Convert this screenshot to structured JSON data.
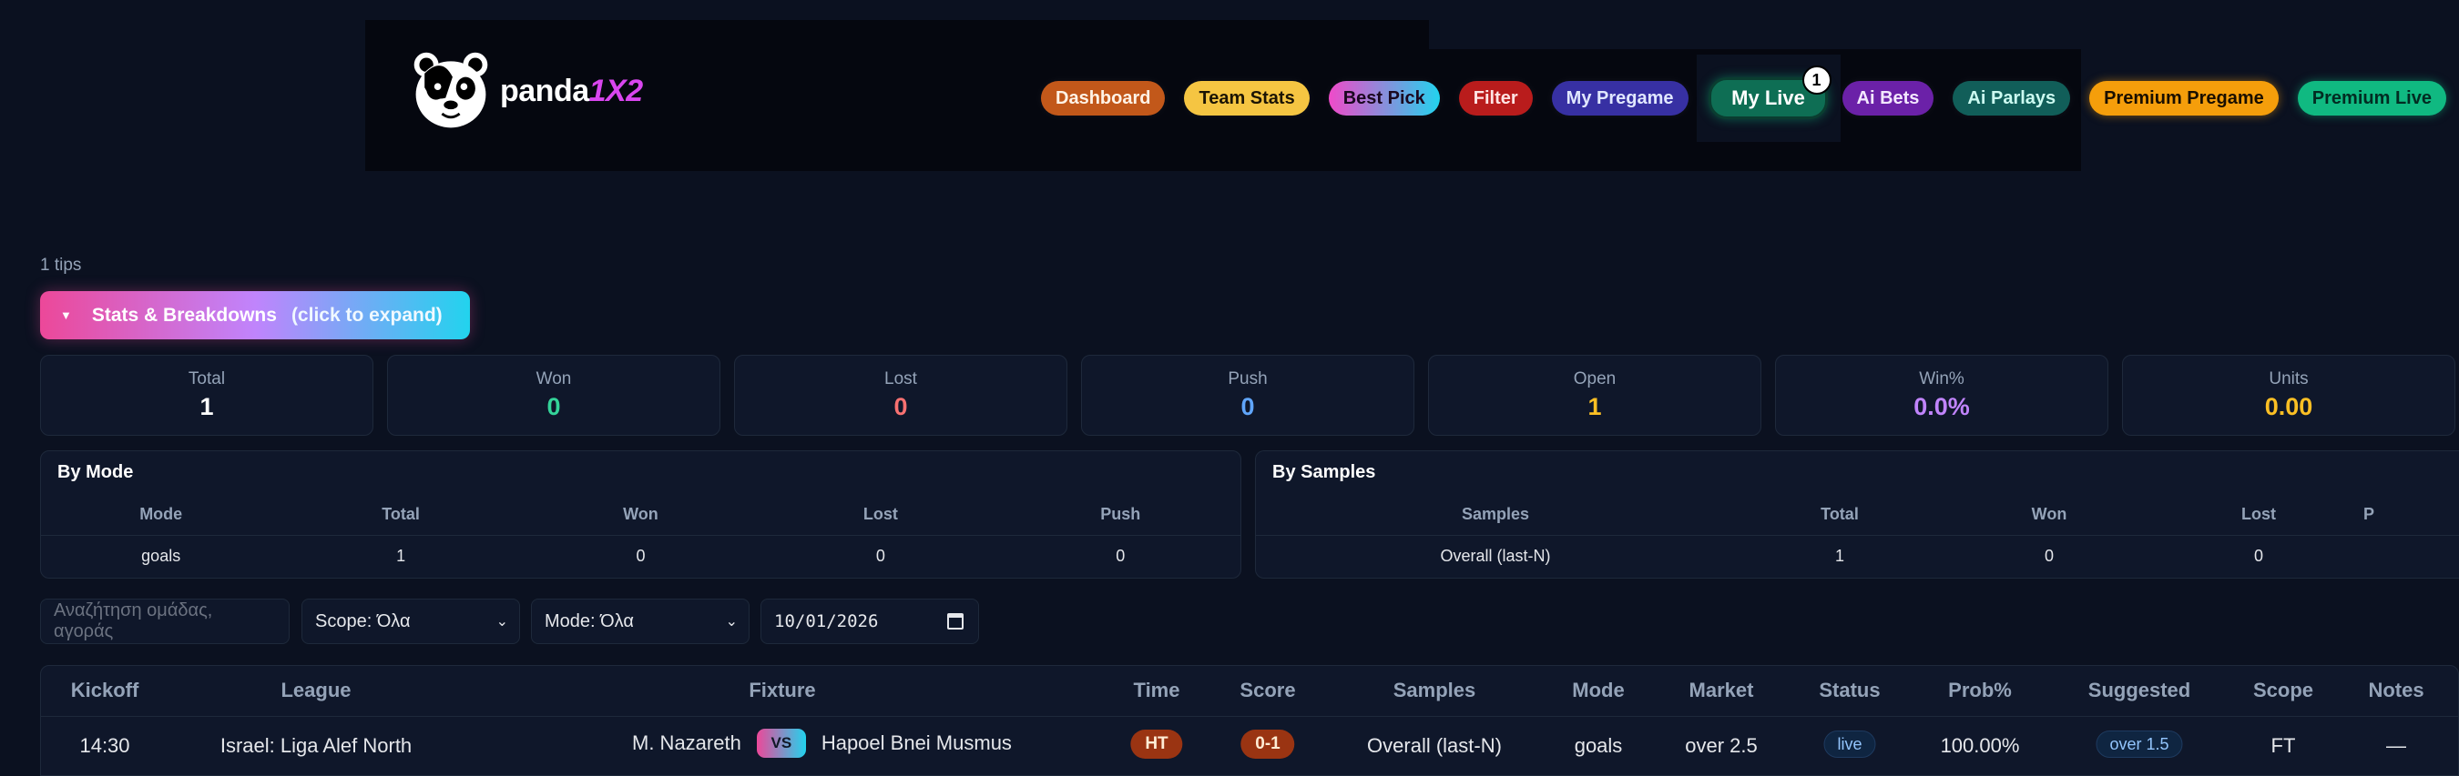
{
  "brand": {
    "name_prefix": "panda",
    "name_accent": "1X2"
  },
  "nav": {
    "items": [
      {
        "label": "Dashboard"
      },
      {
        "label": "Team Stats"
      },
      {
        "label": "Best Pick"
      },
      {
        "label": "Filter"
      },
      {
        "label": "My Pregame"
      },
      {
        "label": "My Live",
        "badge": "1"
      },
      {
        "label": "Ai Bets"
      },
      {
        "label": "Ai Parlays"
      },
      {
        "label": "Premium Pregame"
      },
      {
        "label": "Premium Live"
      }
    ]
  },
  "tips_count": "1 tips",
  "stats_toggle": {
    "arrow": "▼",
    "label": "Stats & Breakdowns",
    "hint": "(click to expand)"
  },
  "kpis": [
    {
      "label": "Total",
      "value": "1",
      "color": "#ffffff"
    },
    {
      "label": "Won",
      "value": "0",
      "color": "#34d399"
    },
    {
      "label": "Lost",
      "value": "0",
      "color": "#f87171"
    },
    {
      "label": "Push",
      "value": "0",
      "color": "#60a5fa"
    },
    {
      "label": "Open",
      "value": "1",
      "color": "#fbbf24"
    },
    {
      "label": "Win%",
      "value": "0.0%",
      "color": "#c084fc"
    },
    {
      "label": "Units",
      "value": "0.00",
      "color": "#fbbf24"
    }
  ],
  "by_mode": {
    "title": "By Mode",
    "headers": [
      "Mode",
      "Total",
      "Won",
      "Lost",
      "Push"
    ],
    "rows": [
      [
        "goals",
        "1",
        "0",
        "0",
        "0"
      ]
    ]
  },
  "by_samples": {
    "title": "By Samples",
    "headers": [
      "Samples",
      "Total",
      "Won",
      "Lost",
      "P"
    ],
    "rows": [
      [
        "Overall (last-N)",
        "1",
        "0",
        "0",
        ""
      ]
    ]
  },
  "filters": {
    "search_placeholder": "Αναζήτηση ομάδας, αγοράς",
    "scope": "Scope: Όλα",
    "mode": "Mode: Όλα",
    "date": "10/01/2026"
  },
  "table": {
    "headers": [
      "Kickoff",
      "League",
      "Fixture",
      "Time",
      "Score",
      "Samples",
      "Mode",
      "Market",
      "Status",
      "Prob%",
      "Suggested",
      "Scope",
      "Notes"
    ],
    "rows": [
      {
        "kickoff": "14:30",
        "league": "Israel: Liga Alef North",
        "home": "M. Nazareth",
        "vs": "VS",
        "away": "Hapoel Bnei Musmus",
        "time": "HT",
        "score": "0-1",
        "samples": "Overall (last-N)",
        "mode": "goals",
        "market": "over 2.5",
        "status": "live",
        "prob": "100.00%",
        "suggested": "over 1.5",
        "scope": "FT",
        "notes": "—"
      }
    ]
  }
}
